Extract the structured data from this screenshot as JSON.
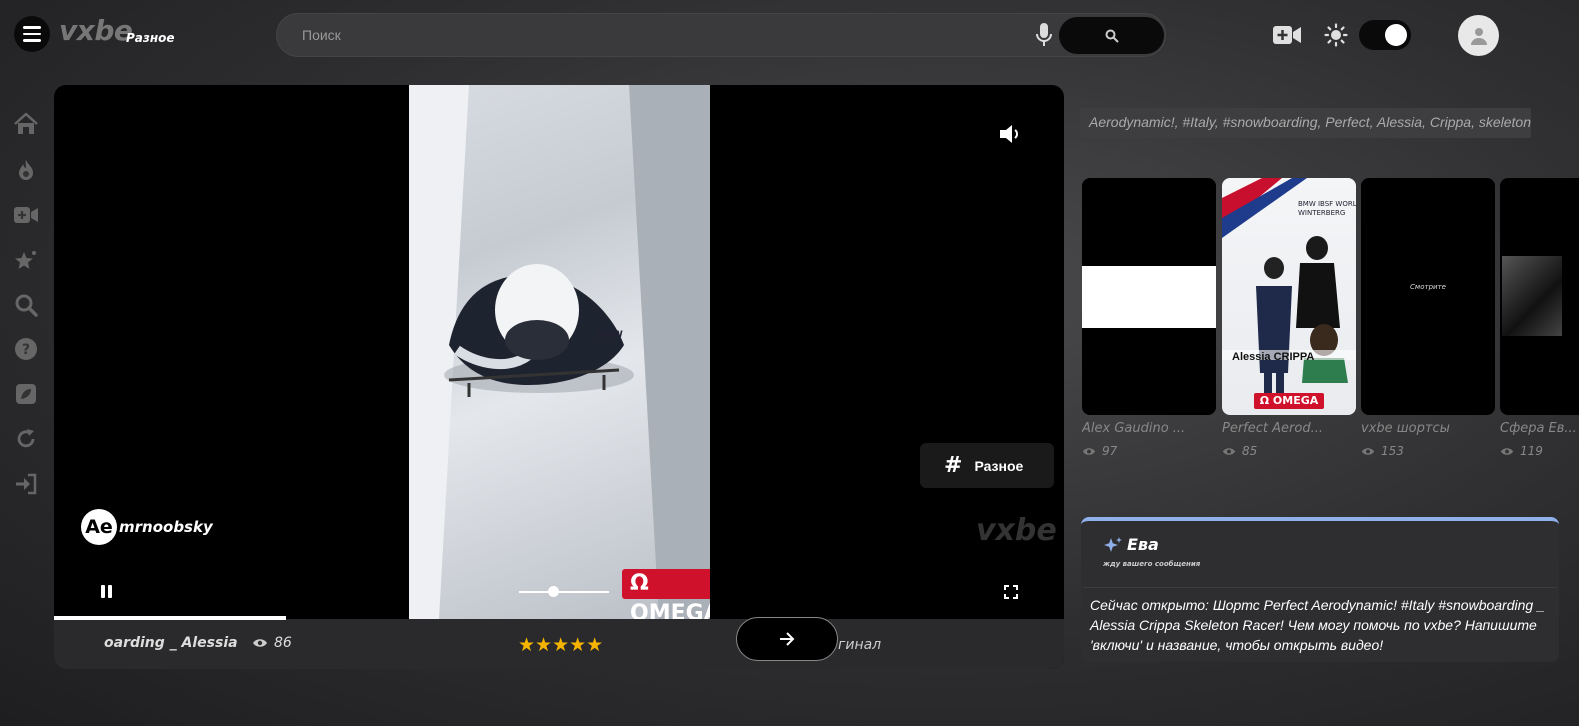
{
  "header": {
    "logo": "vxbe",
    "logo_sub": "Разное",
    "search_placeholder": "Поиск"
  },
  "player": {
    "channel_initials": "Ae",
    "channel_name": "mrnoobsky",
    "watermark": "vxbe",
    "category_label": "Разное",
    "brand_badge": "Ω OMEGA",
    "marquee_title": "oarding _ Alessia Cri",
    "views": "86",
    "stars": "★★★★★",
    "original_label": "гинал",
    "progress_fraction": 0.23,
    "volume_fraction": 0.38
  },
  "tags": "Aerodynamic!, #Italy, #snowboarding, Perfect, Alessia, Crippa, skeleton",
  "cards": [
    {
      "title": "Alex Gaudino ...",
      "views": "97"
    },
    {
      "title": "Perfect Aerod...",
      "views": "85",
      "overlay_name": "Alessia CRIPPA",
      "overlay_brand": "Ω OMEGA",
      "overlay_sign": "BMW IBSF WORLD WINTERBERG"
    },
    {
      "title": "vxbe шортсы",
      "views": "153",
      "overlay_text": "Смотрите"
    },
    {
      "title": "Сфера Ев...",
      "views": "119"
    }
  ],
  "chat": {
    "name": "Ева",
    "status": "жду вашего сообщения",
    "message": "Сейчас открыто: Шортс Perfect Aerodynamic! #Italy #snowboarding _ Alessia Crippa Skeleton Racer! Чем могу помочь по vxbe? Напишите 'включи' и название, чтобы открыть видео!"
  },
  "colors": {
    "accent_chat": "#8fb0e8",
    "stars": "#f5b400",
    "omega_red": "#d0112b"
  }
}
